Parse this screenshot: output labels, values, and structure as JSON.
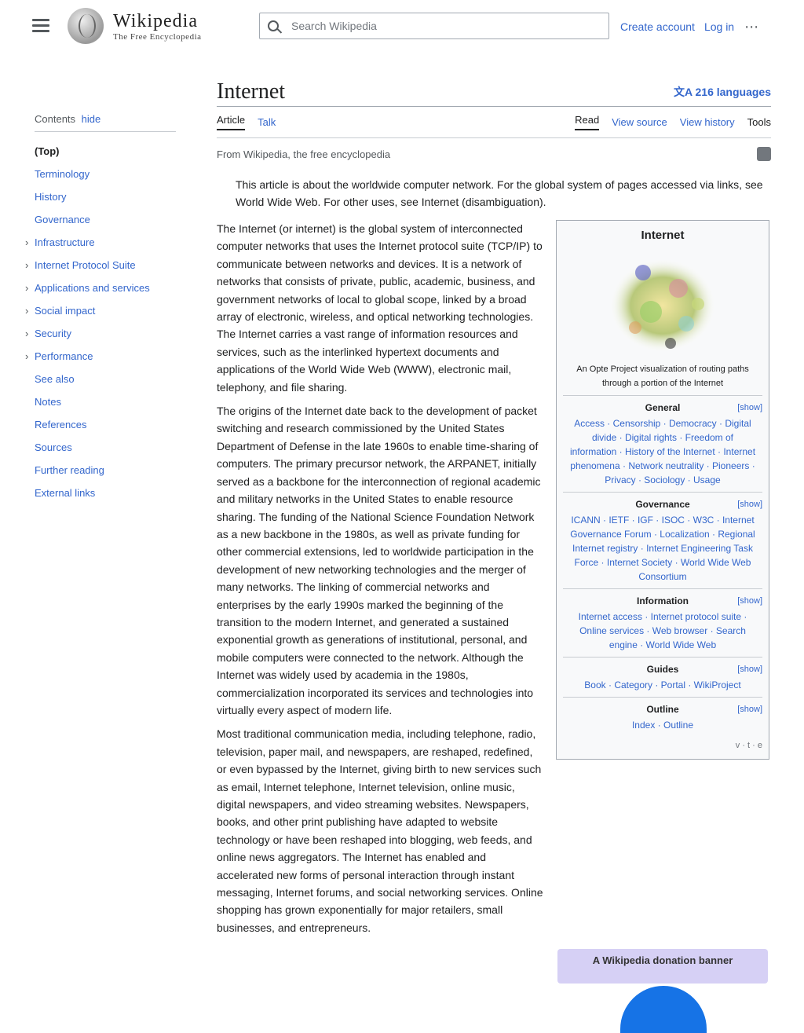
{
  "header": {
    "logo_word": "Wikipedia",
    "logo_sub": "The Free Encyclopedia",
    "search_placeholder": "Search Wikipedia",
    "links": [
      "Create account",
      "Log in"
    ]
  },
  "toc": {
    "title": "Contents",
    "hide_label": "hide",
    "items": [
      {
        "label": "(Top)",
        "top": true,
        "expandable": false
      },
      {
        "label": "Terminology",
        "top": false,
        "expandable": false
      },
      {
        "label": "History",
        "top": false,
        "expandable": false
      },
      {
        "label": "Governance",
        "top": false,
        "expandable": false
      },
      {
        "label": "Infrastructure",
        "top": false,
        "expandable": true
      },
      {
        "label": "Internet Protocol Suite",
        "top": false,
        "expandable": true
      },
      {
        "label": "Applications and services",
        "top": false,
        "expandable": true
      },
      {
        "label": "Social impact",
        "top": false,
        "expandable": true
      },
      {
        "label": "Security",
        "top": false,
        "expandable": true
      },
      {
        "label": "Performance",
        "top": false,
        "expandable": true
      },
      {
        "label": "See also",
        "top": false,
        "expandable": false
      },
      {
        "label": "Notes",
        "top": false,
        "expandable": false
      },
      {
        "label": "References",
        "top": false,
        "expandable": false
      },
      {
        "label": "Sources",
        "top": false,
        "expandable": false
      },
      {
        "label": "Further reading",
        "top": false,
        "expandable": false
      },
      {
        "label": "External links",
        "top": false,
        "expandable": false
      }
    ]
  },
  "article": {
    "title": "Internet",
    "languages_label": "文A 216 languages",
    "tabs_left": [
      "Article",
      "Talk"
    ],
    "tabs_right": [
      "Read",
      "View source",
      "View history",
      "Tools"
    ],
    "tagline": "From Wikipedia, the free encyclopedia",
    "hatnote": "This article is about the worldwide computer network. For the global system of pages accessed via links, see World Wide Web. For other uses, see Internet (disambiguation).",
    "paragraphs": [
      "The Internet (or internet) is the global system of interconnected computer networks that uses the Internet protocol suite (TCP/IP) to communicate between networks and devices. It is a network of networks that consists of private, public, academic, business, and government networks of local to global scope, linked by a broad array of electronic, wireless, and optical networking technologies. The Internet carries a vast range of information resources and services, such as the interlinked hypertext documents and applications of the World Wide Web (WWW), electronic mail, telephony, and file sharing.",
      "The origins of the Internet date back to the development of packet switching and research commissioned by the United States Department of Defense in the late 1960s to enable time-sharing of computers. The primary precursor network, the ARPANET, initially served as a backbone for the interconnection of regional academic and military networks in the United States to enable resource sharing. The funding of the National Science Foundation Network as a new backbone in the 1980s, as well as private funding for other commercial extensions, led to worldwide participation in the development of new networking technologies and the merger of many networks. The linking of commercial networks and enterprises by the early 1990s marked the beginning of the transition to the modern Internet, and generated a sustained exponential growth as generations of institutional, personal, and mobile computers were connected to the network. Although the Internet was widely used by academia in the 1980s, commercialization incorporated its services and technologies into virtually every aspect of modern life.",
      "Most traditional communication media, including telephone, radio, television, paper mail, and newspapers, are reshaped, redefined, or even bypassed by the Internet, giving birth to new services such as email, Internet telephone, Internet television, online music, digital newspapers, and video streaming websites. Newspapers, books, and other print publishing have adapted to website technology or have been reshaped into blogging, web feeds, and online news aggregators. The Internet has enabled and accelerated new forms of personal interaction through instant messaging, Internet forums, and social networking services. Online shopping has grown exponentially for major retailers, small businesses, and entrepreneurs."
    ]
  },
  "infobox": {
    "title": "Internet",
    "caption": "An Opte Project visualization of routing paths through a portion of the Internet",
    "footer": "v · t · e",
    "sections": [
      {
        "title": "General",
        "link": "[show]",
        "text": "Access · Censorship · Democracy · Digital divide · Digital rights · Freedom of information · History of the Internet · Internet phenomena · Network neutrality · Pioneers · Privacy · Sociology · Usage"
      },
      {
        "title": "Governance",
        "link": "[show]",
        "text": "ICANN · IETF · IGF · ISOC · W3C · Internet Governance Forum · Localization · Regional Internet registry · Internet Engineering Task Force · Internet Society · World Wide Web Consortium"
      },
      {
        "title": "Information",
        "link": "[show]",
        "text": "Internet access · Internet protocol suite · Online services · Web browser · Search engine · World Wide Web"
      },
      {
        "title": "Guides",
        "link": "[show]",
        "text": "Book · Category · Portal · WikiProject"
      },
      {
        "title": "Outline",
        "link": "[show]",
        "text": "Index · Outline"
      }
    ]
  },
  "banner": {
    "text": "A Wikipedia donation banner"
  }
}
